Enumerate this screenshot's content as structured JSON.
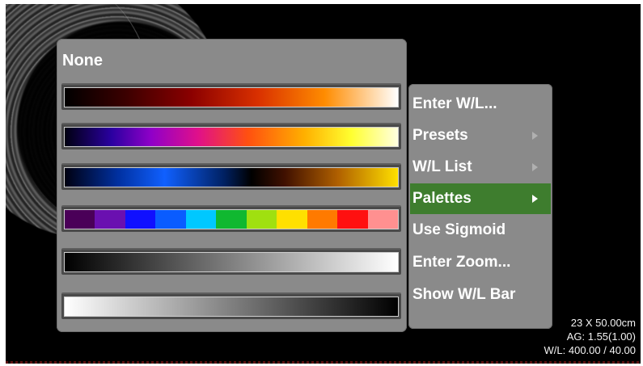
{
  "viewer": {
    "overlay": {
      "dimensions": "23 X 50.00cm",
      "magnification": "AG: 1.55(1.00)",
      "window_level": "W/L: 400.00 / 40.00"
    }
  },
  "palette_menu": {
    "none_label": "None",
    "palettes": [
      {
        "icon": "hot-iron-palette"
      },
      {
        "icon": "rainbow-palette"
      },
      {
        "icon": "cold-hot-palette"
      },
      {
        "icon": "spectrum-palette",
        "colors": [
          "#4a0058",
          "#6a10b0",
          "#1010ff",
          "#0a5cff",
          "#00c8ff",
          "#10b830",
          "#a0e010",
          "#ffe000",
          "#ff7a00",
          "#ff1010",
          "#ff9090"
        ]
      },
      {
        "icon": "grayscale-palette"
      },
      {
        "icon": "inverse-grayscale-palette"
      }
    ]
  },
  "context_menu": {
    "items": [
      {
        "label": "Enter W/L...",
        "has_submenu": false
      },
      {
        "label": "Presets",
        "has_submenu": true
      },
      {
        "label": "W/L List",
        "has_submenu": true
      },
      {
        "label": "Palettes",
        "has_submenu": true,
        "selected": true
      },
      {
        "label": "Use Sigmoid",
        "has_submenu": false
      },
      {
        "label": "Enter Zoom...",
        "has_submenu": false
      },
      {
        "label": "Show W/L Bar",
        "has_submenu": false
      }
    ],
    "selected_color": "#3e7d2e"
  }
}
